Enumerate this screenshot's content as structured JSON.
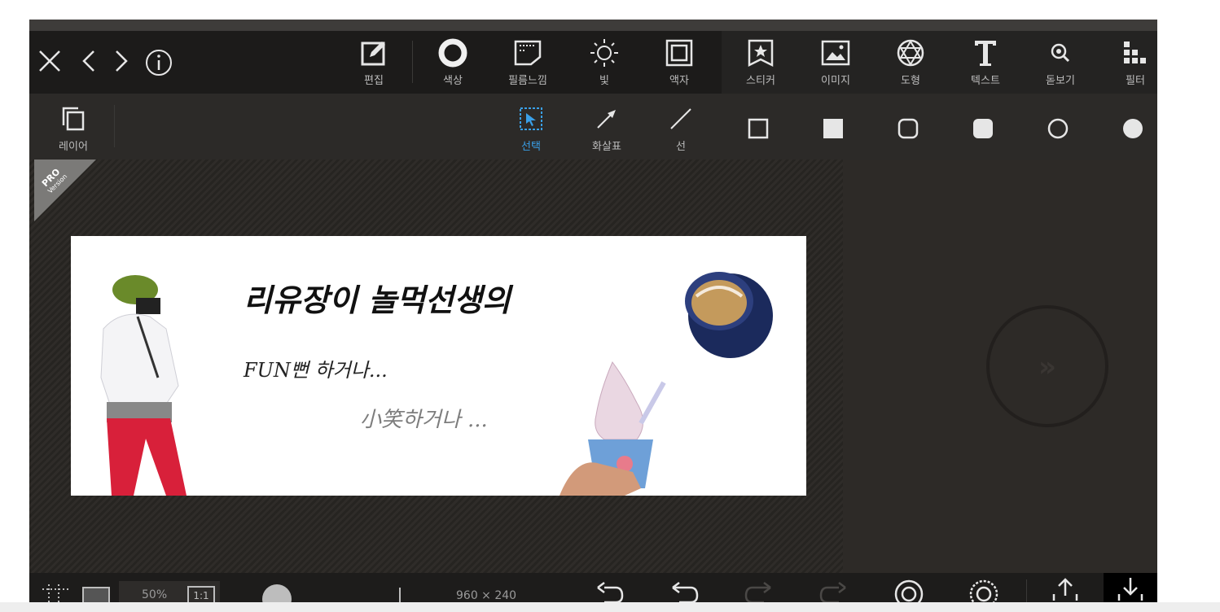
{
  "nav": {
    "close_icon": "close-icon",
    "back_icon": "chevron-left-icon",
    "forward_icon": "chevron-right-icon",
    "info_icon": "info-icon"
  },
  "tools": [
    {
      "label": "편집",
      "icon": "edit-icon"
    },
    {
      "label": "색상",
      "icon": "color-ring-icon"
    },
    {
      "label": "필름느낌",
      "icon": "film-icon"
    },
    {
      "label": "빛",
      "icon": "sun-icon"
    },
    {
      "label": "액자",
      "icon": "frame-icon"
    },
    {
      "label": "스티커",
      "icon": "sticker-icon"
    },
    {
      "label": "이미지",
      "icon": "image-icon"
    },
    {
      "label": "도형",
      "icon": "shape-icon"
    },
    {
      "label": "텍스트",
      "icon": "text-icon"
    },
    {
      "label": "돋보기",
      "icon": "magnifier-icon"
    },
    {
      "label": "필터",
      "icon": "filter-icon"
    }
  ],
  "layer": {
    "label": "레이어",
    "icon": "layers-icon"
  },
  "shape_tools": [
    {
      "label": "선택",
      "icon": "select-icon",
      "active": true
    },
    {
      "label": "화살표",
      "icon": "arrow-icon"
    },
    {
      "label": "선",
      "icon": "line-icon"
    }
  ],
  "shapes": [
    "square-outline-icon",
    "square-filled-icon",
    "rounded-square-outline-icon",
    "rounded-square-filled-icon",
    "circle-outline-icon",
    "circle-filled-icon"
  ],
  "badge": {
    "line1": "PRO",
    "line2": "Version"
  },
  "banner": {
    "title": "리유장이 놀먹선생의",
    "line2": "FUN뻔 하거나...",
    "line3": "小笑하거나 ..."
  },
  "bottom": {
    "zoom": "50%",
    "ratio": "1:1",
    "size": "960 × 240"
  },
  "colors": {
    "accent": "#3aa0e8",
    "bg": "#2b2825",
    "toolbar": "#1c1b1a"
  }
}
